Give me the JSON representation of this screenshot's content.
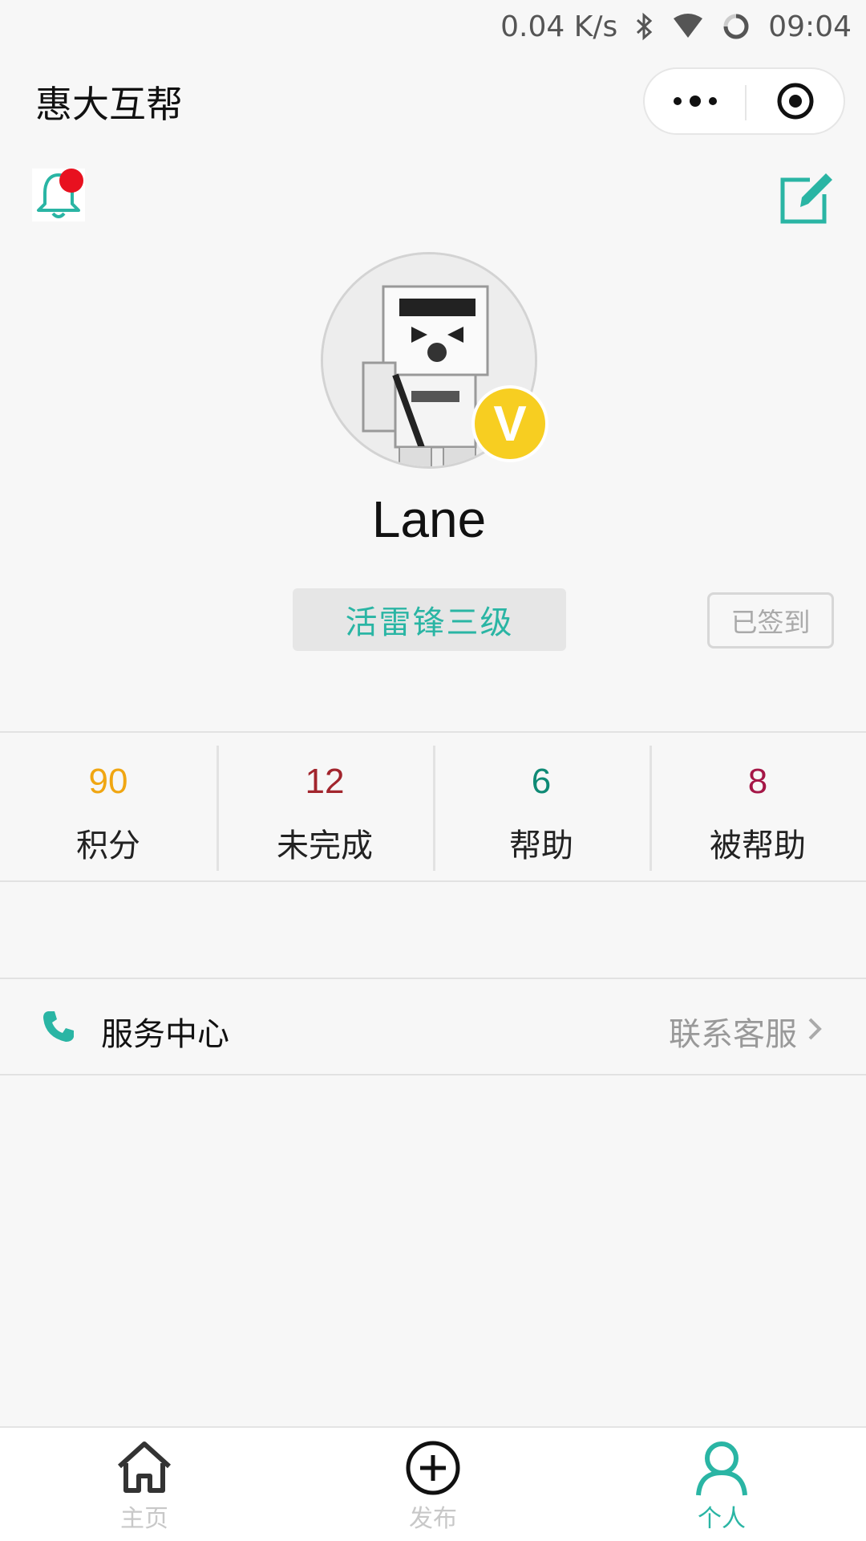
{
  "status_bar": {
    "net_speed": "0.04 K/s",
    "time": "09:04",
    "icons": [
      "bluetooth-icon",
      "wifi-icon",
      "loading-icon"
    ]
  },
  "header": {
    "title": "惠大互帮",
    "capsule_icons": [
      "more-icon",
      "target-icon"
    ]
  },
  "profile": {
    "username": "Lane",
    "badge": "V",
    "level": "活雷锋三级",
    "sign_status": "已签到",
    "has_notification": true
  },
  "stats": [
    {
      "value": "90",
      "label": "积分",
      "color": "#f0a612"
    },
    {
      "value": "12",
      "label": "未完成",
      "color": "#a2252d"
    },
    {
      "value": "6",
      "label": "帮助",
      "color": "#0f8a75"
    },
    {
      "value": "8",
      "label": "被帮助",
      "color": "#a51747"
    }
  ],
  "service": {
    "label": "服务中心",
    "action": "联系客服"
  },
  "tabbar": {
    "items": [
      {
        "label": "主页",
        "icon": "home-icon",
        "active": false
      },
      {
        "label": "发布",
        "icon": "plus-circle-icon",
        "active": false
      },
      {
        "label": "个人",
        "icon": "user-icon",
        "active": true
      }
    ]
  },
  "colors": {
    "accent": "#2ab5a4",
    "badge": "#f7ce21",
    "notification": "#e8111f",
    "background": "#f7f7f7"
  }
}
